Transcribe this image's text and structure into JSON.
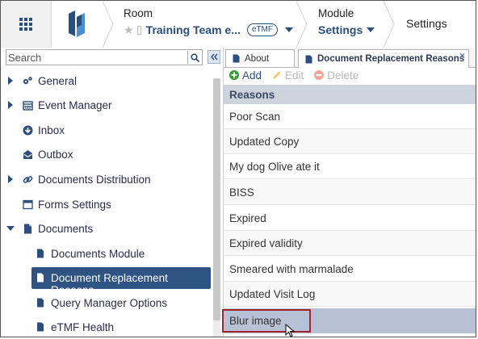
{
  "header": {
    "room_label": "Room",
    "room_name": "Training Team e...",
    "room_badge": "eTMF",
    "module_label": "Module",
    "module_name": "Settings",
    "current_page": "Settings",
    "accent_color": "#2b4e7c"
  },
  "search": {
    "placeholder": "Search",
    "value": ""
  },
  "sidebar": {
    "items": [
      {
        "label": "General",
        "icon": "gears-icon",
        "expander": "collapsed"
      },
      {
        "label": "Event Manager",
        "icon": "calendar-icon",
        "expander": "collapsed"
      },
      {
        "label": "Inbox",
        "icon": "inbox-icon",
        "expander": "none"
      },
      {
        "label": "Outbox",
        "icon": "outbox-icon",
        "expander": "none"
      },
      {
        "label": "Documents Distribution",
        "icon": "link-icon",
        "expander": "collapsed"
      },
      {
        "label": "Forms Settings",
        "icon": "form-icon",
        "expander": "none"
      },
      {
        "label": "Documents",
        "icon": "document-icon",
        "expander": "expanded"
      },
      {
        "label": "Documents Module",
        "icon": "document-icon",
        "level": 1
      },
      {
        "label": "Document Replacement Reasons",
        "icon": "document-icon",
        "level": 1,
        "selected": true
      },
      {
        "label": "Query Manager Options",
        "icon": "document-icon",
        "level": 1
      },
      {
        "label": "eTMF Health",
        "icon": "document-icon",
        "level": 1
      }
    ]
  },
  "tabs": [
    {
      "label": "About",
      "active": false
    },
    {
      "label": "Document Replacement Reasons",
      "active": true
    }
  ],
  "toolbar": {
    "add_label": "Add",
    "edit_label": "Edit",
    "delete_label": "Delete"
  },
  "grid": {
    "column_header": "Reasons",
    "rows": [
      "Poor Scan",
      "Updated Copy",
      "My dog Olive ate it",
      "BISS",
      "Expired",
      "Expired validity",
      "Smeared with marmalade",
      "Updated Visit Log",
      "Blur image"
    ],
    "selected_row": "Blur image"
  }
}
